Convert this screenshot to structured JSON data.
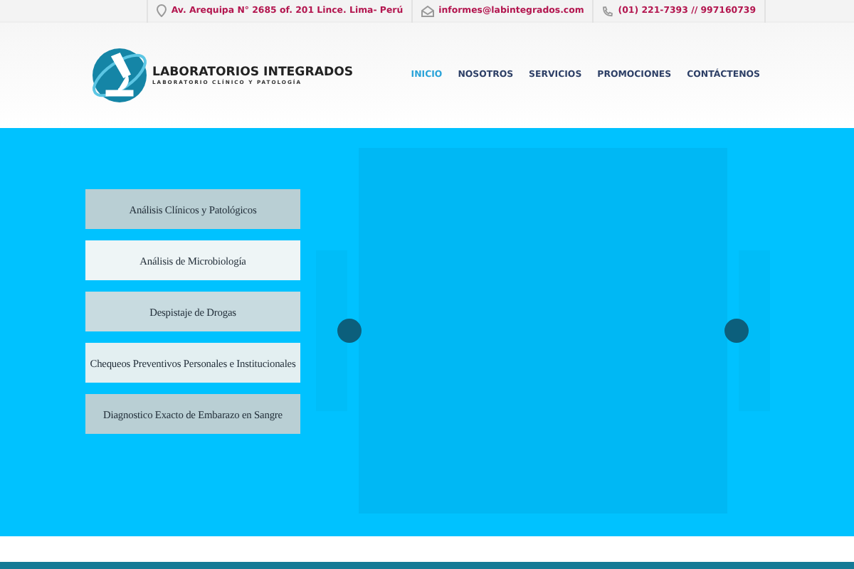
{
  "top_bar": {
    "address": "Av. Arequipa N° 2685 of. 201 Lince. Lima- Perú",
    "email": "informes@labintegrados.com",
    "phone": "(01) 221-7393 // 997160739"
  },
  "logo": {
    "title": "LABORATORIOS INTEGRADOS",
    "subtitle": "LABORATORIO CLÍNICO Y PATOLOGÍA"
  },
  "nav": [
    {
      "label": "INICIO",
      "selected": true
    },
    {
      "label": "NOSOTROS",
      "selected": false
    },
    {
      "label": "SERVICIOS",
      "selected": false
    },
    {
      "label": "PROMOCIONES",
      "selected": false
    },
    {
      "label": "CONTÁCTENOS",
      "selected": false
    }
  ],
  "services": [
    {
      "label": "Análisis Clínicos y Patológicos",
      "color": "#b9cfd4"
    },
    {
      "label": "Análisis de Microbiología",
      "color": "#eef5f6"
    },
    {
      "label": "Despistaje de Drogas",
      "color": "#c8dbe0"
    },
    {
      "label": "Chequeos Preventivos Personales e Institucionales",
      "color": "#e3eff1"
    },
    {
      "label": "Diagnostico Exacto de Embarazo en Sangre",
      "color": "#b9cfd4"
    }
  ]
}
